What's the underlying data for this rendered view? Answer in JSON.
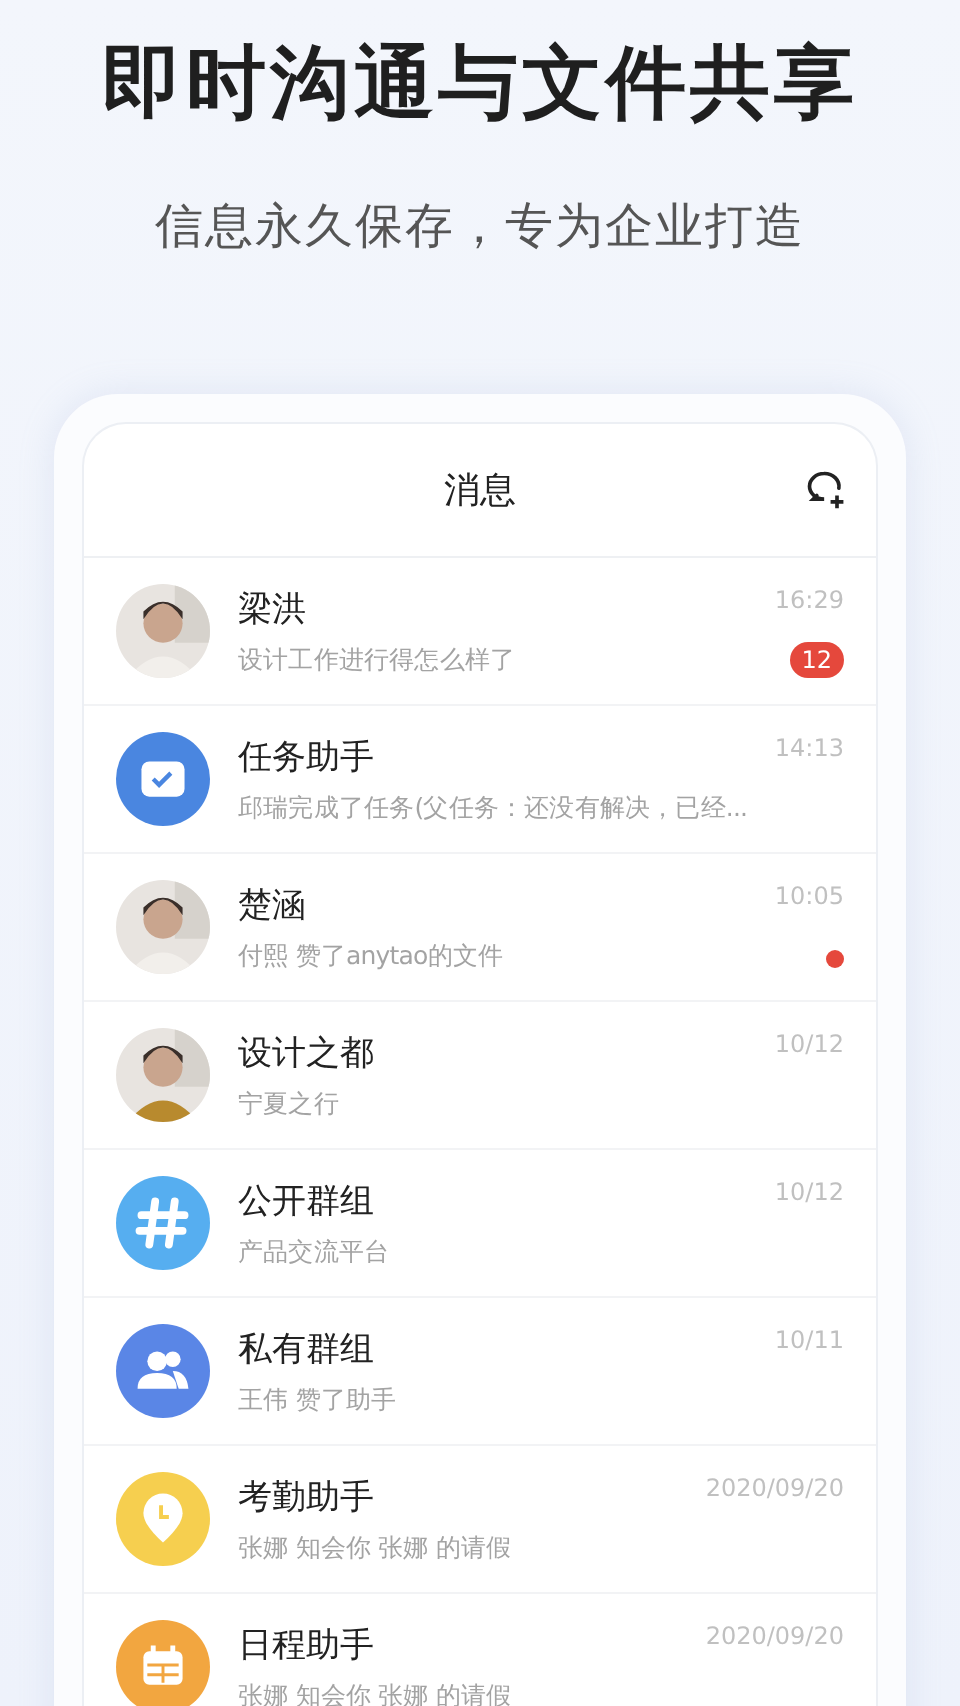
{
  "headline": "即时沟通与文件共享",
  "subtitle": "信息永久保存，专为企业打造",
  "screen": {
    "title": "消息",
    "conversations": [
      {
        "name": "梁洪",
        "preview": "设计工作进行得怎么样了",
        "time": "16:29",
        "badge": {
          "kind": "count",
          "text": "12"
        }
      },
      {
        "name": "任务助手",
        "preview": "邱瑞完成了任务(父任务：还没有解决，已经...",
        "time": "14:13",
        "avatar": {
          "kind": "check",
          "color": "#4a86e0"
        }
      },
      {
        "name": "楚涵",
        "preview": "付熙 赞了anytao的文件",
        "time": "10:05",
        "badge": {
          "kind": "dot"
        }
      },
      {
        "name": "设计之都",
        "preview": "宁夏之行",
        "time": "10/12"
      },
      {
        "name": "公开群组",
        "preview": "产品交流平台",
        "time": "10/12",
        "avatar": {
          "kind": "hash",
          "color": "#56aef0"
        }
      },
      {
        "name": "私有群组",
        "preview": "王伟 赞了助手",
        "time": "10/11",
        "avatar": {
          "kind": "people",
          "color": "#5a86e6"
        }
      },
      {
        "name": "考勤助手",
        "preview": "张娜 知会你 张娜 的请假",
        "time": "2020/09/20",
        "avatar": {
          "kind": "pin",
          "color": "#f6cf4f"
        }
      },
      {
        "name": "日程助手",
        "preview": "张娜 知会你 张娜 的请假",
        "time": "2020/09/20",
        "avatar": {
          "kind": "calendar",
          "color": "#f2a640"
        }
      }
    ]
  }
}
